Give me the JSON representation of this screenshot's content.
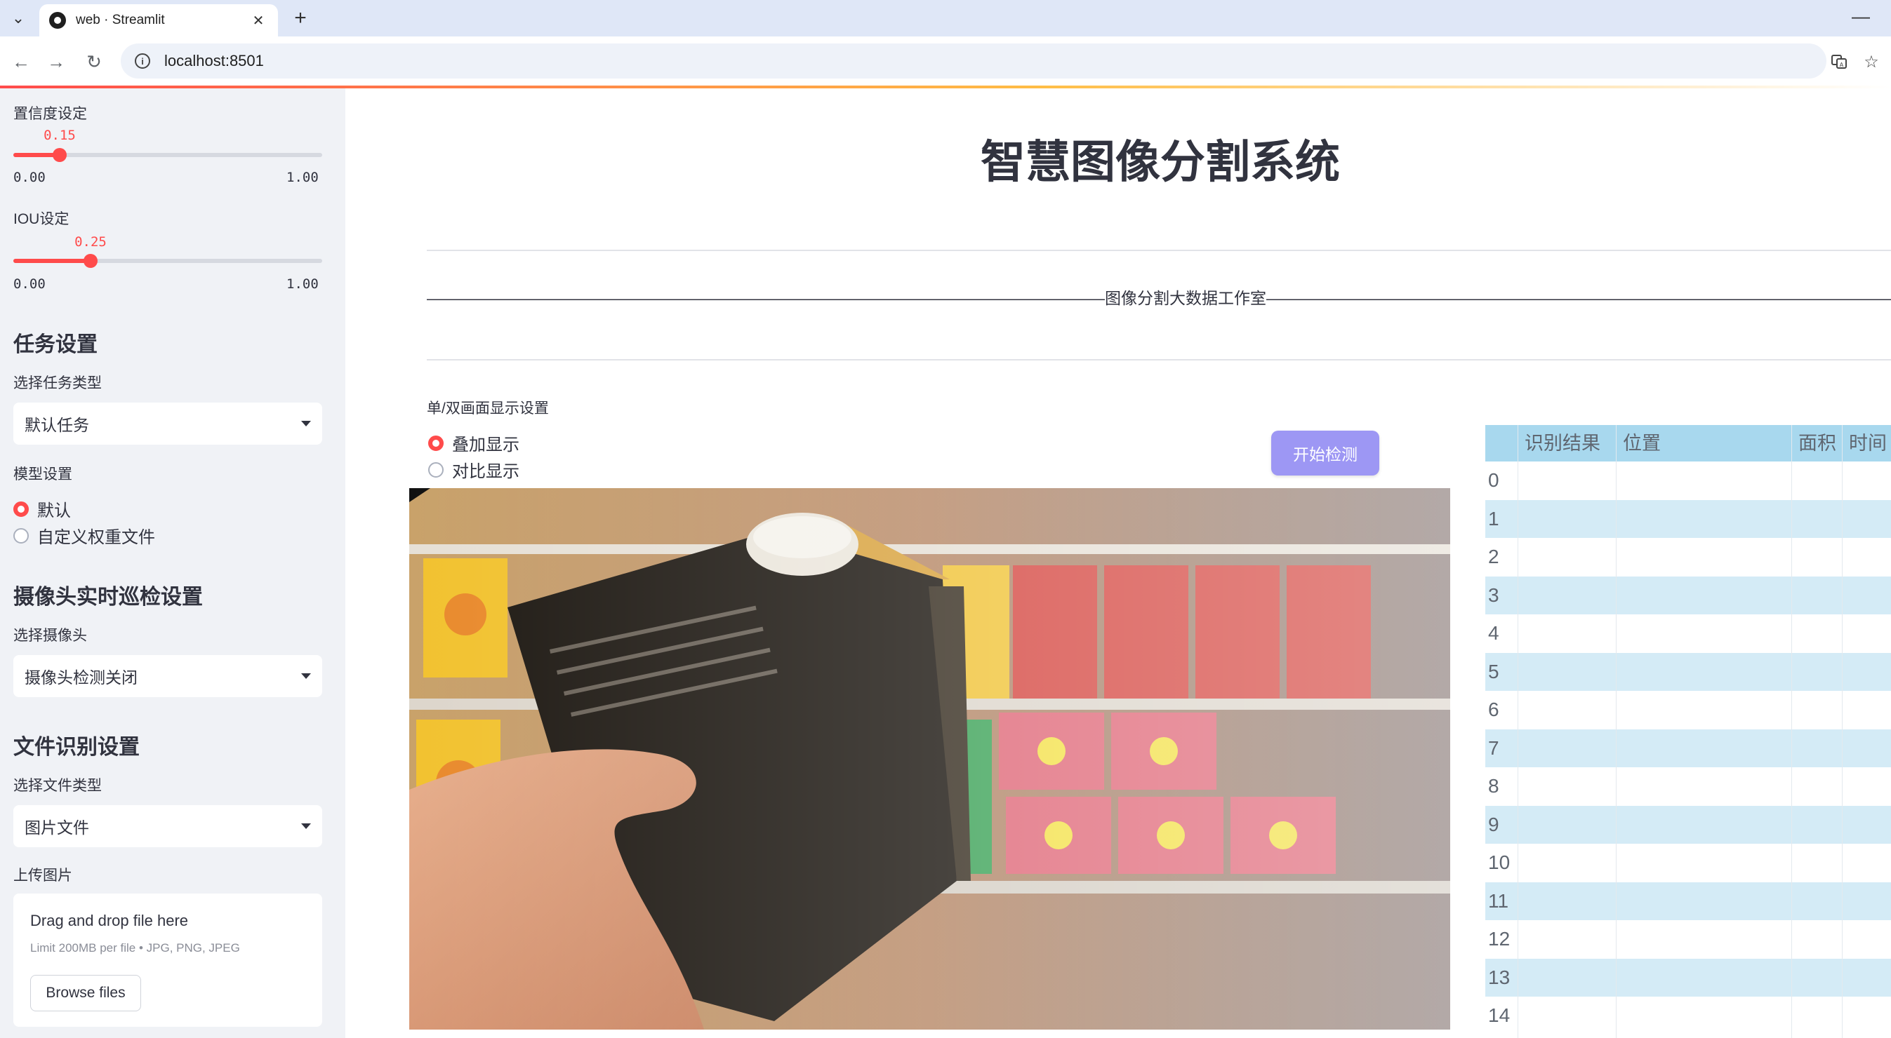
{
  "browser": {
    "tab_title": "web · Streamlit",
    "url": "localhost:8501"
  },
  "sidebar": {
    "confidence": {
      "label": "置信度设定",
      "value_text": "0.15",
      "value": 0.15,
      "min_text": "0.00",
      "max_text": "1.00"
    },
    "iou": {
      "label": "IOU设定",
      "value_text": "0.25",
      "value": 0.25,
      "min_text": "0.00",
      "max_text": "1.00"
    },
    "task": {
      "heading": "任务设置",
      "label": "选择任务类型",
      "selected": "默认任务"
    },
    "model": {
      "label": "模型设置",
      "options": [
        "默认",
        "自定义权重文件"
      ],
      "selected_index": 0
    },
    "camera": {
      "heading": "摄像头实时巡检设置",
      "label": "选择摄像头",
      "selected": "摄像头检测关闭"
    },
    "file": {
      "heading": "文件识别设置",
      "label": "选择文件类型",
      "selected": "图片文件"
    },
    "upload": {
      "label": "上传图片",
      "title": "Drag and drop file here",
      "limit": "Limit 200MB per file • JPG, PNG, JPEG",
      "button": "Browse files"
    }
  },
  "main": {
    "title": "智慧图像分割系统",
    "studio_line": "——————————————————————————————————————————图像分割大数据工作室——————————————————————————————————————————————",
    "display_label": "单/双画面显示设置",
    "display_options": [
      "叠加显示",
      "对比显示"
    ],
    "display_selected_index": 0,
    "detect_button": "开始检测"
  },
  "table": {
    "columns": [
      "识别结果",
      "位置",
      "面积",
      "时间"
    ],
    "row_indices": [
      "0",
      "1",
      "2",
      "3",
      "4",
      "5",
      "6",
      "7",
      "8",
      "9",
      "10",
      "11",
      "12",
      "13",
      "14"
    ]
  },
  "colors": {
    "accent": "#ff4b4b",
    "button": "#9d97f4",
    "table_header": "#a8d8ee",
    "table_alt_row": "#d4ebf6"
  }
}
